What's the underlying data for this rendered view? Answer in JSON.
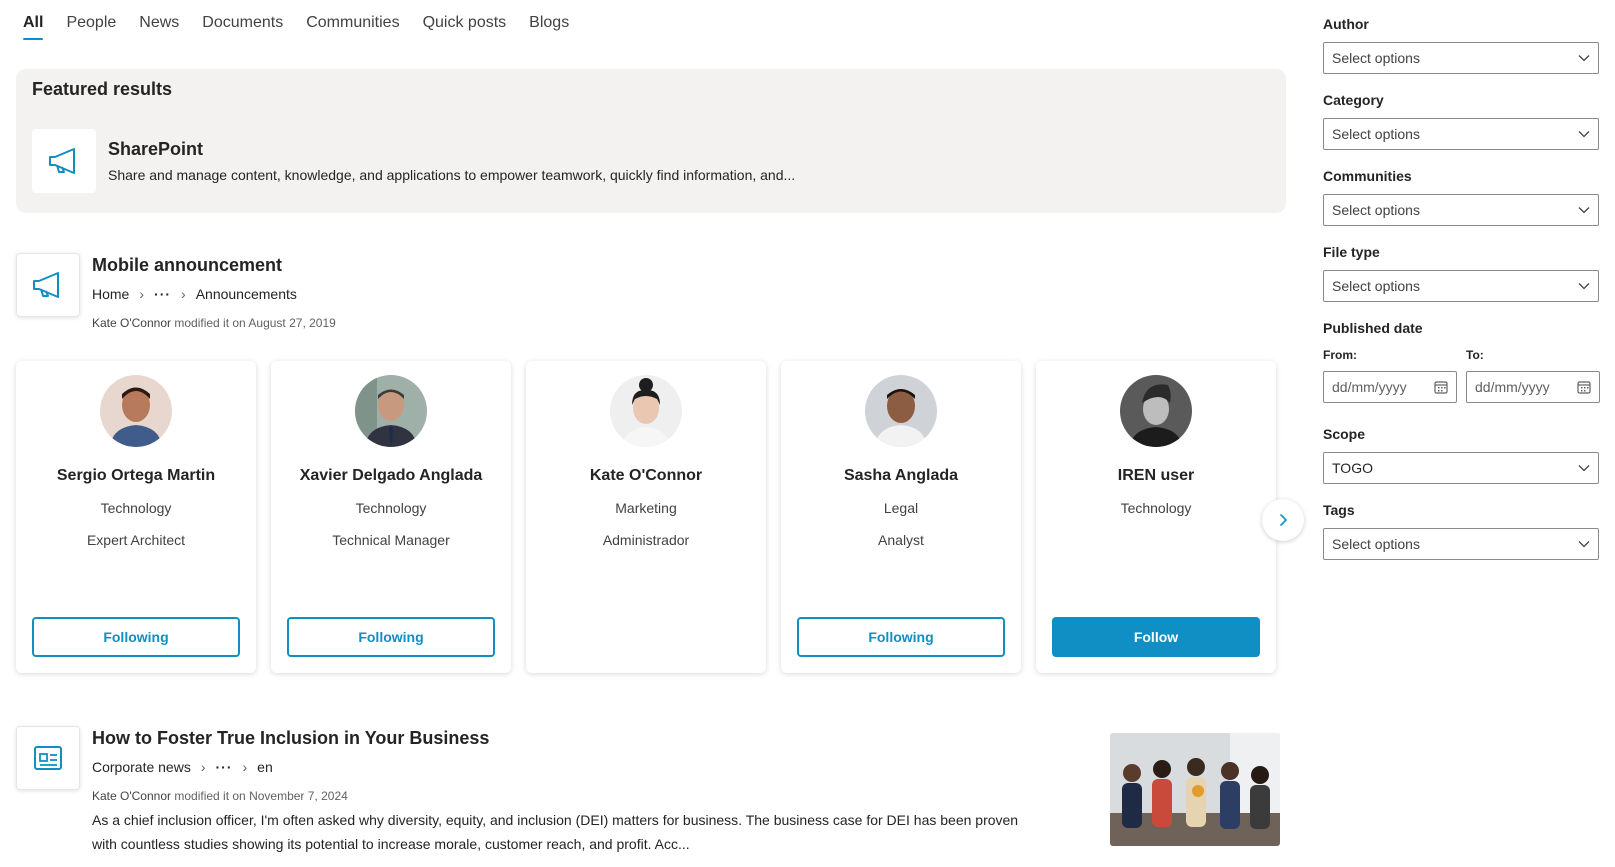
{
  "tabs": [
    {
      "label": "All",
      "active": true
    },
    {
      "label": "People"
    },
    {
      "label": "News"
    },
    {
      "label": "Documents"
    },
    {
      "label": "Communities"
    },
    {
      "label": "Quick posts"
    },
    {
      "label": "Blogs"
    }
  ],
  "featured": {
    "heading": "Featured results",
    "item_title": "SharePoint",
    "item_description": "Share and manage content, knowledge, and applications to empower teamwork, quickly find information, and..."
  },
  "results": [
    {
      "title": "Mobile announcement",
      "breadcrumb": [
        "Home",
        "···",
        "Announcements"
      ],
      "author": "Kate O'Connor",
      "modified_text": "modified it on August 27, 2019"
    },
    {
      "title": "How to Foster True Inclusion in Your Business",
      "breadcrumb": [
        "Corporate news",
        "···",
        "en"
      ],
      "author": "Kate O'Connor",
      "modified_text": "modified it on November 7, 2024",
      "snippet": "As a chief inclusion officer, I'm often asked why diversity, equity, and inclusion (DEI) matters for business. The business case for DEI has been proven with countless studies showing its potential to increase morale, customer reach, and profit. Acc..."
    }
  ],
  "people": [
    {
      "name": "Sergio Ortega Martin",
      "department": "Technology",
      "role": "Expert Architect",
      "button": "Following"
    },
    {
      "name": "Xavier Delgado Anglada",
      "department": "Technology",
      "role": "Technical Manager",
      "button": "Following"
    },
    {
      "name": "Kate O'Connor",
      "department": "Marketing",
      "role": "Administrador",
      "button": ""
    },
    {
      "name": "Sasha Anglada",
      "department": "Legal",
      "role": "Analyst",
      "button": "Following"
    },
    {
      "name": "IREN user",
      "department": "Technology",
      "role": "",
      "button": "Follow"
    }
  ],
  "filters": {
    "author": {
      "label": "Author",
      "value": "Select options"
    },
    "category": {
      "label": "Category",
      "value": "Select options"
    },
    "communities": {
      "label": "Communities",
      "value": "Select options"
    },
    "file_type": {
      "label": "File type",
      "value": "Select options"
    },
    "published_date": {
      "label": "Published date",
      "from_label": "From:",
      "to_label": "To:",
      "from_placeholder": "dd/mm/yyyy",
      "to_placeholder": "dd/mm/yyyy"
    },
    "scope": {
      "label": "Scope",
      "value": "TOGO"
    },
    "tags": {
      "label": "Tags",
      "value": "Select options"
    }
  },
  "colors": {
    "accent": "#0f8fc4",
    "featured_bg": "#f3f2f1"
  },
  "icons": {
    "announcement": "megaphone-icon",
    "news": "newspaper-icon",
    "chevron": "chevron-down-icon",
    "calendar": "calendar-icon",
    "next": "chevron-right-icon"
  }
}
